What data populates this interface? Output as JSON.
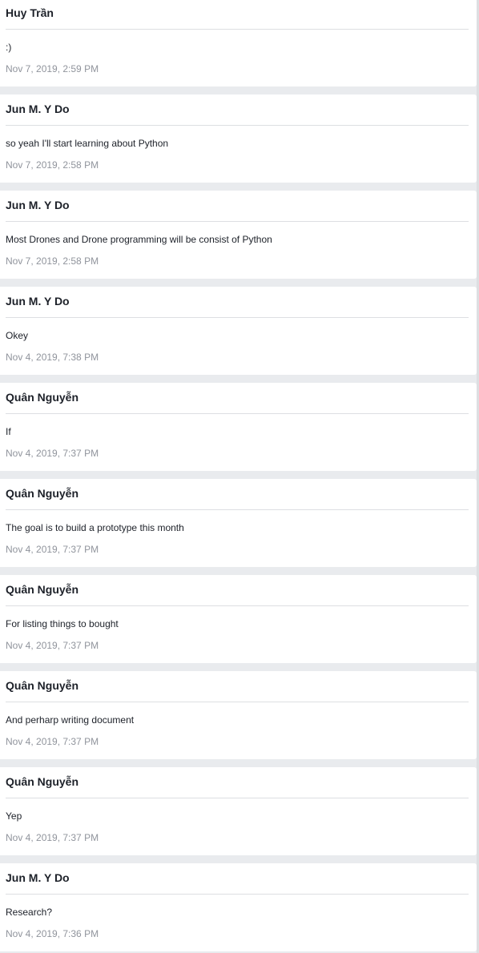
{
  "messages": [
    {
      "sender": "Huy Trần",
      "text": ":)",
      "time": "Nov 7, 2019, 2:59 PM"
    },
    {
      "sender": "Jun M. Y Do",
      "text": "so yeah I'll start learning about Python",
      "time": "Nov 7, 2019, 2:58 PM"
    },
    {
      "sender": "Jun M. Y Do",
      "text": "Most Drones and Drone programming will be consist of Python",
      "time": "Nov 7, 2019, 2:58 PM"
    },
    {
      "sender": "Jun M. Y Do",
      "text": "Okey",
      "time": "Nov 4, 2019, 7:38 PM"
    },
    {
      "sender": "Quân Nguyễn",
      "text": "If",
      "time": "Nov 4, 2019, 7:37 PM"
    },
    {
      "sender": "Quân Nguyễn",
      "text": "The goal is to build a prototype this month",
      "time": "Nov 4, 2019, 7:37 PM"
    },
    {
      "sender": "Quân Nguyễn",
      "text": "For listing things to bought",
      "time": "Nov 4, 2019, 7:37 PM"
    },
    {
      "sender": "Quân Nguyễn",
      "text": "And perharp writing document",
      "time": "Nov 4, 2019, 7:37 PM"
    },
    {
      "sender": "Quân Nguyễn",
      "text": "Yep",
      "time": "Nov 4, 2019, 7:37 PM"
    },
    {
      "sender": "Jun M. Y Do",
      "text": "Research?",
      "time": "Nov 4, 2019, 7:36 PM"
    }
  ]
}
